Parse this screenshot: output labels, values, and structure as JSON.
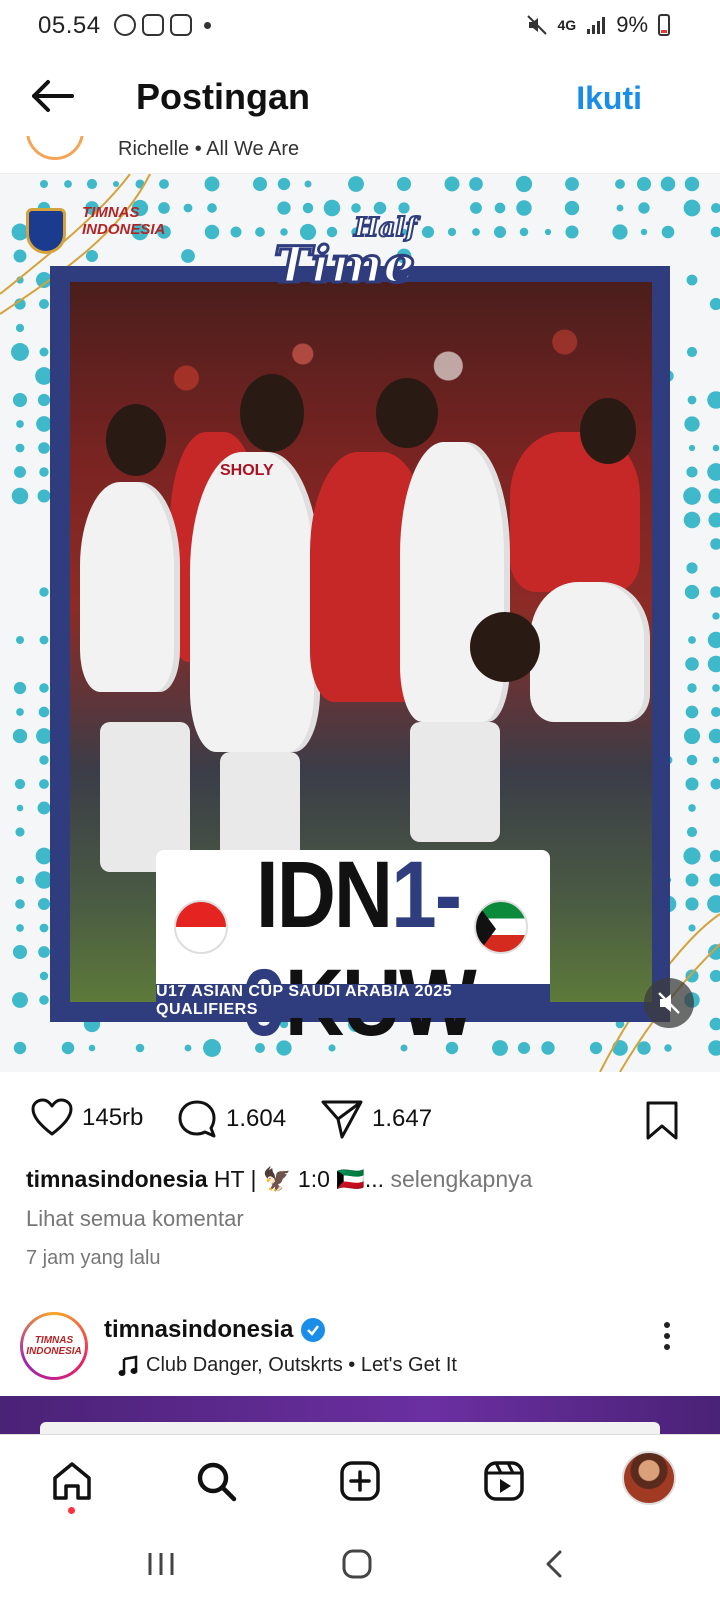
{
  "status_bar": {
    "time": "05.54",
    "network": "4G",
    "battery": "9%",
    "icons": [
      "whatsapp-icon",
      "app-icon",
      "app-icon",
      "mute-icon",
      "signal-icon",
      "battery-icon"
    ]
  },
  "header": {
    "title": "Postingan",
    "follow_label": "Ikuti"
  },
  "previous_post": {
    "music": "Richelle • All We Are"
  },
  "post": {
    "image_title": "Half Time",
    "logo_text": "TIMNAS INDONESIA",
    "score": {
      "home": "IDN",
      "home_goals": "1",
      "separator": "-",
      "away_goals": "0",
      "away": "KUW"
    },
    "tournament": "U17 ASIAN CUP SAUDI ARABIA 2025 QUALIFIERS",
    "jersey_name": "SHOLY",
    "likes": "145rb",
    "comments": "1.604",
    "shares": "1.647",
    "caption_user": "timnasindonesia",
    "caption_text": "HT | 🦅 1:0 🇰🇼...",
    "caption_more": "selengkapnya",
    "view_comments": "Lihat semua komentar",
    "timestamp": "7 jam yang lalu"
  },
  "next_post": {
    "username": "timnasindonesia",
    "verified": true,
    "music": "Club Danger, Outskrts • Let's Get It",
    "avatar_text": "TIMNAS INDONESIA"
  },
  "colors": {
    "accent_blue": "#1a8de9",
    "frame_navy": "#2f3c7e",
    "dots_teal": "#3fb8c9",
    "notification_red": "#ff3040"
  }
}
